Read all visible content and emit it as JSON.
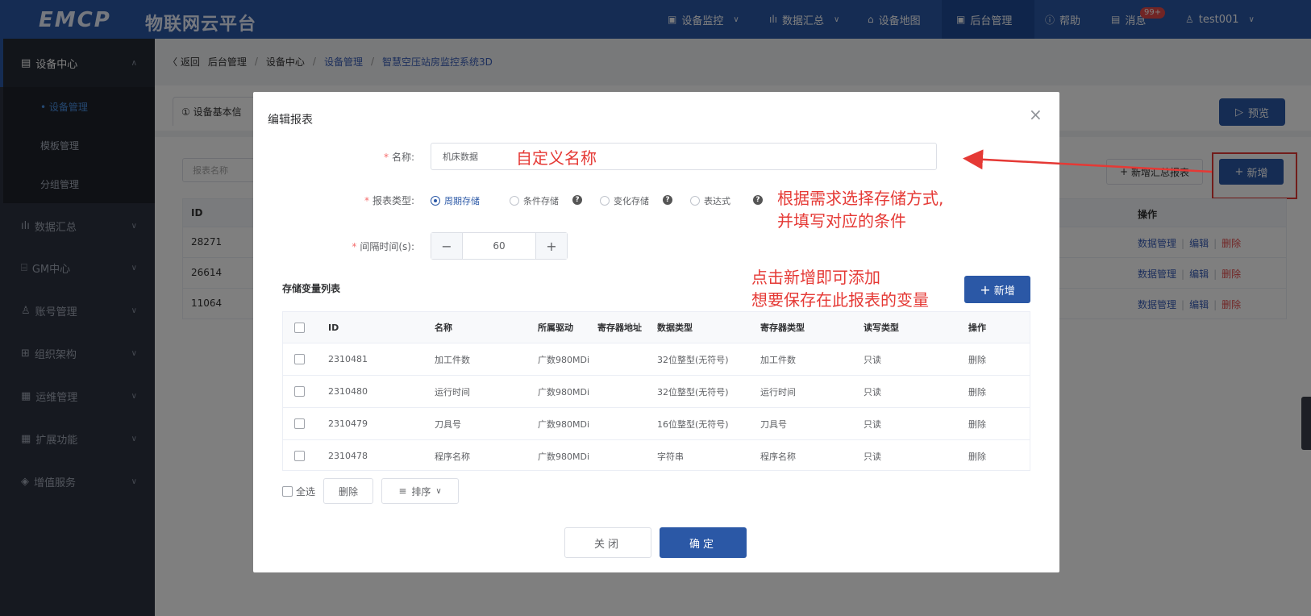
{
  "topbar": {
    "logo": "EMCP",
    "logo_sub": "物联网云平台",
    "nav": [
      {
        "label": "设备监控",
        "icon": "monitor-icon"
      },
      {
        "label": "数据汇总",
        "icon": "bar-chart-icon"
      },
      {
        "label": "设备地图",
        "icon": "map-pin-icon"
      },
      {
        "label": "后台管理",
        "icon": "admin-icon"
      },
      {
        "label": "帮助",
        "icon": "help-icon"
      },
      {
        "label": "消息",
        "icon": "message-icon"
      },
      {
        "label": "test001",
        "icon": "user-icon"
      }
    ],
    "badge": "99+"
  },
  "sidebar": {
    "header": "设备中心",
    "sub_items": [
      {
        "label": "• 设备管理"
      },
      {
        "label": "模板管理"
      },
      {
        "label": "分组管理"
      }
    ],
    "items": [
      {
        "label": "数据汇总"
      },
      {
        "label": "GM中心"
      },
      {
        "label": "账号管理"
      },
      {
        "label": "组织架构"
      },
      {
        "label": "运维管理"
      },
      {
        "label": "扩展功能"
      },
      {
        "label": "增值服务"
      }
    ]
  },
  "breadcrumb": {
    "back": "〈 返回",
    "items": [
      "后台管理",
      "设备中心",
      "设备管理",
      "智慧空压站房监控系统3D"
    ]
  },
  "background": {
    "tab_basic": "① 设备基本信",
    "preview_button": "预览",
    "search_placeholder": "报表名称",
    "add_summary_button": "新增汇总报表",
    "add_button": "新增",
    "col_id": "ID",
    "col_ops": "操作",
    "rows": [
      {
        "id": "28271",
        "op1": "数据管理",
        "op2": "编辑",
        "op3": "删除"
      },
      {
        "id": "26614",
        "op1": "数据管理",
        "op2": "编辑",
        "op3": "删除"
      },
      {
        "id": "11064",
        "op1": "数据管理",
        "op2": "编辑",
        "op3": "删除"
      }
    ]
  },
  "modal": {
    "title": "编辑报表",
    "name_label": "名称:",
    "name_value": "机床数据",
    "type_label": "报表类型:",
    "types": [
      "周期存储",
      "条件存储",
      "变化存储",
      "表达式"
    ],
    "interval_label": "间隔时间(s):",
    "interval_value": "60",
    "section_label": "存储变量列表",
    "add_button": "新增",
    "columns": [
      "ID",
      "名称",
      "所属驱动",
      "寄存器地址",
      "数据类型",
      "寄存器类型",
      "读写类型",
      "操作"
    ],
    "rows": [
      {
        "id": "2310481",
        "name": "加工件数",
        "driver": "广数980MDi",
        "addr": "",
        "dtype": "32位整型(无符号)",
        "rtype": "加工件数",
        "rw": "只读",
        "op": "删除"
      },
      {
        "id": "2310480",
        "name": "运行时间",
        "driver": "广数980MDi",
        "addr": "",
        "dtype": "32位整型(无符号)",
        "rtype": "运行时间",
        "rw": "只读",
        "op": "删除"
      },
      {
        "id": "2310479",
        "name": "刀具号",
        "driver": "广数980MDi",
        "addr": "",
        "dtype": "16位整型(无符号)",
        "rtype": "刀具号",
        "rw": "只读",
        "op": "删除"
      },
      {
        "id": "2310478",
        "name": "程序名称",
        "driver": "广数980MDi",
        "addr": "",
        "dtype": "字符串",
        "rtype": "程序名称",
        "rw": "只读",
        "op": "删除"
      }
    ],
    "select_all": "全选",
    "delete_button": "删除",
    "sort_button": "排序",
    "close_button": "关闭",
    "ok_button": "确定"
  },
  "annotations": {
    "name_hint": "自定义名称",
    "type_hint_1": "根据需求选择存储方式,",
    "type_hint_2": "并填写对应的条件",
    "add_hint_1": "点击新增即可添加",
    "add_hint_2": "想要保存在此报表的变量"
  },
  "colors": {
    "primary": "#2b58a6",
    "annotation": "#e53935",
    "danger": "#e34a4a"
  }
}
